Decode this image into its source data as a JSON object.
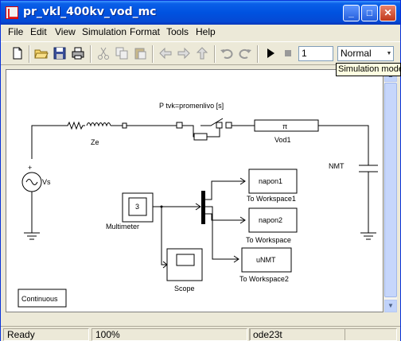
{
  "window": {
    "title": "pr_vkl_400kv_vod_mc"
  },
  "titlebar_buttons": {
    "minimize": "_",
    "maximize": "□",
    "close": "✕"
  },
  "menu": [
    "File",
    "Edit",
    "View",
    "Simulation",
    "Format",
    "Tools",
    "Help"
  ],
  "toolbar": {
    "icons": [
      "new-icon",
      "open-icon",
      "save-icon",
      "print-icon",
      "cut-icon",
      "copy-icon",
      "paste-icon",
      "back-icon",
      "forward-icon",
      "up-icon",
      "undo-icon",
      "redo-icon",
      "start-simulation-icon",
      "stop-simulation-icon"
    ],
    "stop_time": "1",
    "sim_mode": "Normal",
    "tooltip": "Simulation mode"
  },
  "diagram": {
    "switch_label": "P tvk=promenlivo [s]",
    "impedance_label": "Ze",
    "source_label": "Vs",
    "line_label": "Vod1",
    "line_symbol": "π",
    "capacitor_label": "NMT",
    "multimeter_value": "3",
    "multimeter_label": "Multimeter",
    "scope_label": "Scope",
    "ws1_value": "napon1",
    "ws1_label": "To Workspace1",
    "ws2_value": "napon2",
    "ws2_label": "To Workspace",
    "ws3_value": "uNMT",
    "ws3_label": "To Workspace2",
    "continuous_label": "Continuous"
  },
  "status": {
    "state": "Ready",
    "zoom": "100%",
    "solver": "ode23t"
  },
  "colors": {
    "titlebar": "#0052e0",
    "canvas": "#ffffff",
    "tooltip_bg": "#ffffe1"
  }
}
